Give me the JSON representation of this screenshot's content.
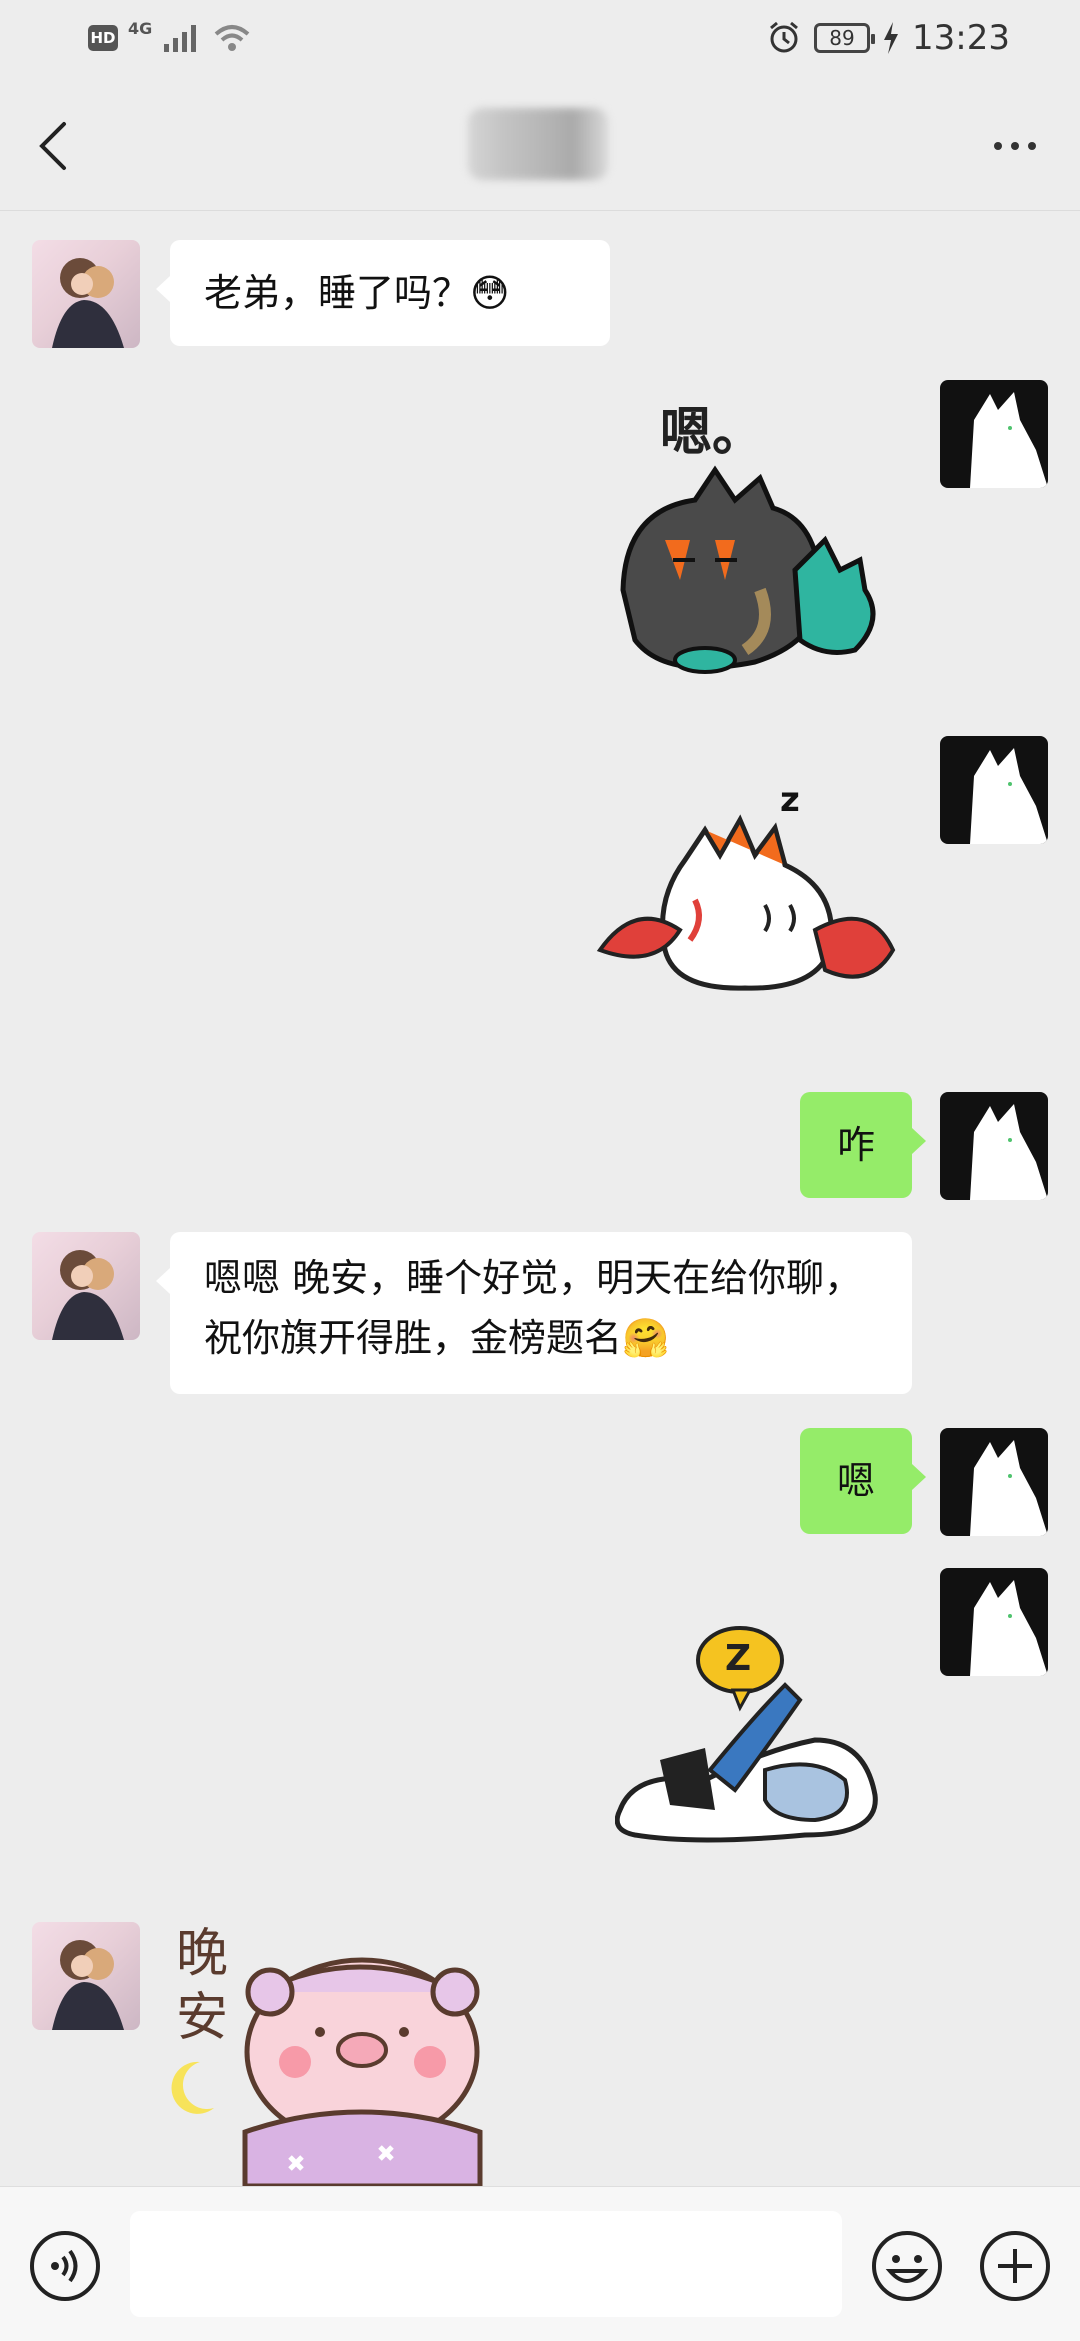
{
  "status_bar": {
    "hd": "HD",
    "network": "4G",
    "battery": "89",
    "time": "13:23"
  },
  "header": {
    "title": ""
  },
  "messages": {
    "m1": {
      "text": "老弟，睡了吗？😳"
    },
    "m2": {
      "sticker_text": "嗯。"
    },
    "m3": {
      "sticker_text": "z"
    },
    "m4": {
      "text": "咋"
    },
    "m5": {
      "text": "嗯嗯 晚安，睡个好觉，明天在给你聊，祝你旗开得胜，金榜题名🤗"
    },
    "m6": {
      "text": "嗯"
    },
    "m7": {
      "sticker_text": "Z"
    },
    "m8": {
      "sticker_text": "晚安"
    }
  },
  "input": {
    "value": "",
    "placeholder": ""
  },
  "icons": [
    "back-icon",
    "more-icon",
    "voice-icon",
    "emoji-icon",
    "plus-icon"
  ],
  "colors": {
    "background": "#ededed",
    "sent_bubble": "#95ec69",
    "received_bubble": "#ffffff"
  }
}
